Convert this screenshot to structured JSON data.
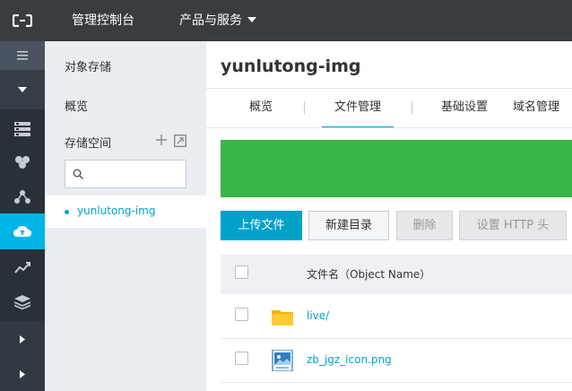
{
  "topbar": {
    "logo_icon": "aliyun-logo-icon",
    "console_label": "管理控制台",
    "products_label": "产品与服务"
  },
  "rail": {
    "items": [
      {
        "icon": "menu-icon"
      },
      {
        "icon": "collapse-arrow-icon"
      },
      {
        "icon": "server-icon"
      },
      {
        "icon": "cluster-icon"
      },
      {
        "icon": "network-icon"
      },
      {
        "icon": "cloud-storage-icon"
      },
      {
        "icon": "analytics-icon"
      },
      {
        "icon": "layers-icon"
      },
      {
        "icon": "chevron-right-icon"
      },
      {
        "icon": "chevron-right-icon"
      }
    ],
    "active_color": "#00b4e8"
  },
  "sidebar": {
    "title": "对象存储",
    "overview": "概览",
    "bucket_label": "存储空间",
    "search_placeholder": "",
    "buckets": [
      {
        "name": "yunlutong-img"
      }
    ]
  },
  "main": {
    "bucket_title": "yunlutong-img",
    "tabs": [
      {
        "label": "概览"
      },
      {
        "label": "文件管理"
      },
      {
        "label": "基础设置"
      },
      {
        "label": "域名管理"
      }
    ],
    "active_tab": "文件管理",
    "banner_color": "#3ab54a",
    "buttons": {
      "upload": "上传文件",
      "new_dir": "新建目录",
      "delete": "删除",
      "http_header": "设置 HTTP 头"
    },
    "table": {
      "column_name": "文件名（Object Name）",
      "rows": [
        {
          "name": "live/",
          "type": "folder",
          "icon": "folder-icon"
        },
        {
          "name": "zb_jgz_icon.png",
          "type": "image",
          "icon": "image-file-icon"
        }
      ]
    }
  },
  "colors": {
    "accent": "#00a2ca",
    "topbar": "#373d41",
    "rail": "#293038"
  }
}
